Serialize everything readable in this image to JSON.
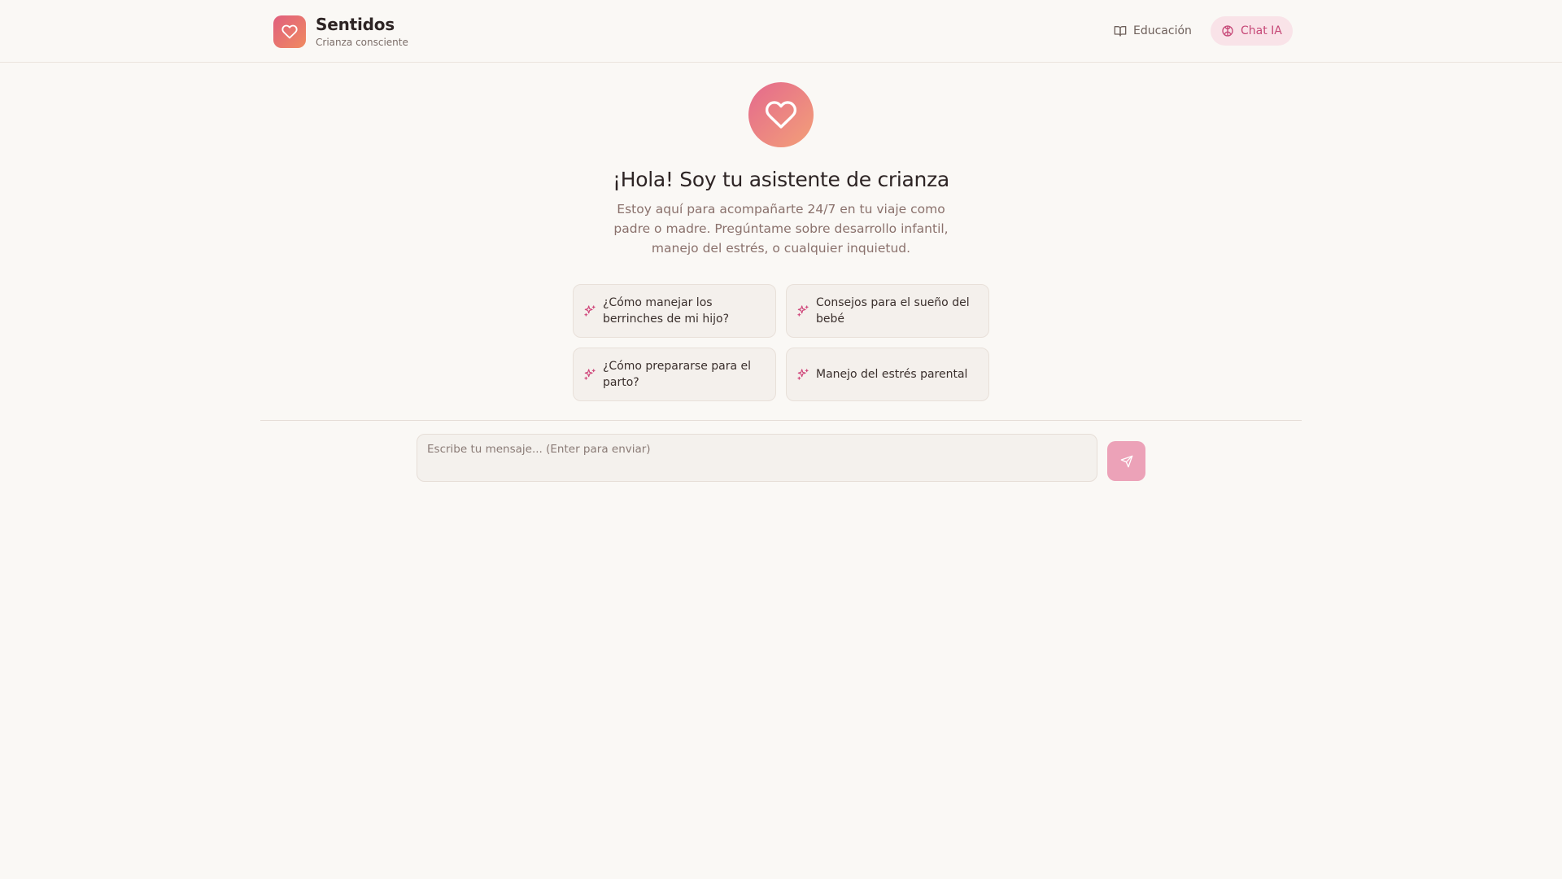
{
  "brand": {
    "name": "Sentidos",
    "tagline": "Crianza consciente"
  },
  "nav": [
    {
      "label": "Educación",
      "icon": "book-open-icon",
      "active": false
    },
    {
      "label": "Chat IA",
      "icon": "brain-icon",
      "active": true
    }
  ],
  "hero": {
    "icon": "heart-icon",
    "title": "¡Hola! Soy tu asistente de crianza",
    "description": "Estoy aquí para acompañarte 24/7 en tu viaje como padre o madre. Pregúntame sobre desarrollo infantil, manejo del estrés, o cualquier inquietud."
  },
  "suggestions": [
    {
      "label": "¿Cómo manejar los berrinches de mi hijo?",
      "icon": "sparkles-icon"
    },
    {
      "label": "Consejos para el sueño del bebé",
      "icon": "sparkles-icon"
    },
    {
      "label": "¿Cómo prepararse para el parto?",
      "icon": "sparkles-icon"
    },
    {
      "label": "Manejo del estrés parental",
      "icon": "sparkles-icon"
    }
  ],
  "composer": {
    "placeholder": "Escribe tu mensaje... (Enter para enviar)",
    "value": "",
    "send_icon": "send-icon"
  },
  "colors": {
    "background": "#faf8f5",
    "accent": "#c64877",
    "accent_soft": "#f9e3e8",
    "brand_gradient_start": "#e05f7e",
    "brand_gradient_end": "#f08a60",
    "send_button": "#eca2b8"
  }
}
